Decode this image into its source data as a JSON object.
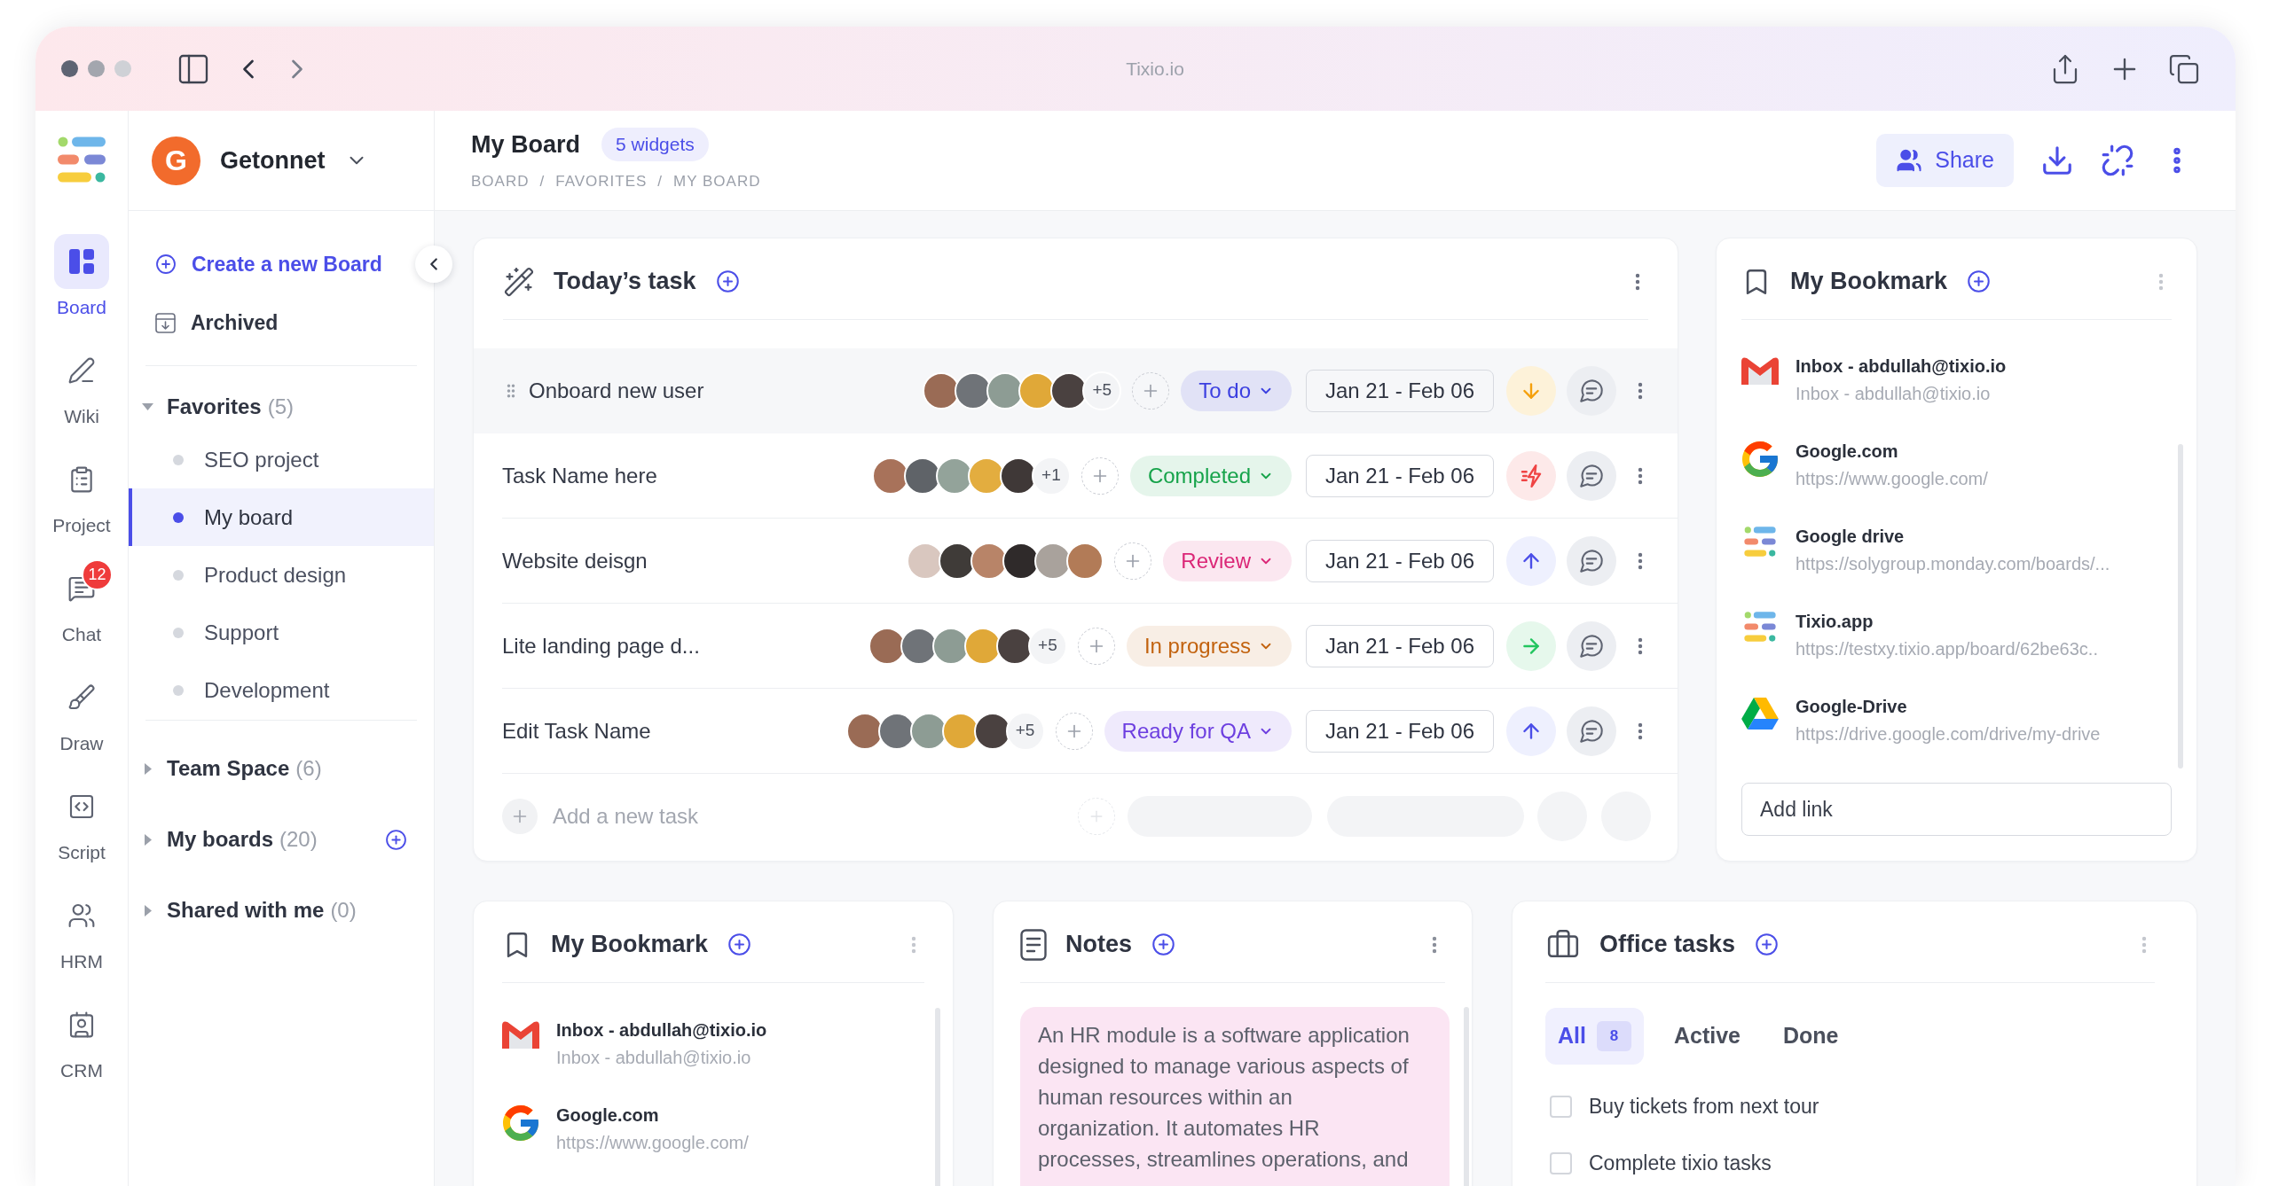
{
  "window": {
    "title": "Tixio.io"
  },
  "rail": {
    "items": [
      {
        "label": "Board",
        "selected": true
      },
      {
        "label": "Wiki",
        "selected": false
      },
      {
        "label": "Project",
        "selected": false
      },
      {
        "label": "Chat",
        "selected": false,
        "badge": "12"
      },
      {
        "label": "Draw",
        "selected": false
      },
      {
        "label": "Script",
        "selected": false
      },
      {
        "label": "HRM",
        "selected": false
      },
      {
        "label": "CRM",
        "selected": false
      }
    ]
  },
  "workspace": {
    "initial": "G",
    "name": "Getonnet"
  },
  "nav": {
    "actions": [
      {
        "label": "Create a new Board",
        "kind": "create"
      },
      {
        "label": "Archived",
        "kind": "archive"
      }
    ],
    "sections": [
      {
        "label": "Favorites",
        "count": "(5)",
        "expanded": true,
        "children": [
          {
            "label": "SEO project",
            "selected": false
          },
          {
            "label": "My board",
            "selected": true
          },
          {
            "label": "Product design",
            "selected": false
          },
          {
            "label": "Support",
            "selected": false
          },
          {
            "label": "Development",
            "selected": false
          }
        ]
      },
      {
        "label": "Team Space",
        "count": "(6)",
        "expanded": false
      },
      {
        "label": "My boards",
        "count": "(20)",
        "expanded": false,
        "action": {
          "kind": "add"
        }
      },
      {
        "label": "Shared with me",
        "count": "(0)",
        "expanded": false
      }
    ]
  },
  "header": {
    "title": "My Board",
    "badge": "5 widgets",
    "breadcrumb": [
      {
        "label": "BOARD",
        "separator": "/"
      },
      {
        "label": "FAVORITES",
        "separator": "/"
      },
      {
        "label": "MY BOARD"
      }
    ],
    "share_label": "Share"
  },
  "todays_task": {
    "title": "Today’s task",
    "tasks": [
      {
        "name": "Onboard new user",
        "highlighted": true,
        "avatars": [
          {
            "color": "#9a6b55"
          },
          {
            "color": "#6f7378"
          },
          {
            "color": "#8d9c94"
          },
          {
            "color": "#e0a838"
          },
          {
            "color": "#4a4140"
          }
        ],
        "more": "+5",
        "status": {
          "label": "To do",
          "color": "#3b3fe0"
        },
        "date": "Jan 21 - Feb 06",
        "priority": {
          "kind": "low"
        }
      },
      {
        "name": "Task Name here",
        "highlighted": false,
        "avatars": [
          {
            "color": "#a8725a"
          },
          {
            "color": "#5f6368"
          },
          {
            "color": "#93a39a"
          },
          {
            "color": "#e3ad3f"
          },
          {
            "color": "#3f3837"
          }
        ],
        "more": "+1",
        "status": {
          "label": "Completed",
          "color": "#16a34a"
        },
        "date": "Jan 21 - Feb 06",
        "priority": {
          "kind": "urgent"
        }
      },
      {
        "name": "Website deisgn",
        "highlighted": false,
        "avatars": [
          {
            "color": "#d9c7bf"
          },
          {
            "color": "#3f3b38"
          },
          {
            "color": "#b88468"
          },
          {
            "color": "#2f2a2a"
          },
          {
            "color": "#a9a29c"
          },
          {
            "color": "#b27b57"
          }
        ],
        "status": {
          "label": "Review",
          "color": "#db2777"
        },
        "date": "Jan 21 - Feb 06",
        "priority": {
          "kind": "high"
        }
      },
      {
        "name": "Lite landing page d...",
        "highlighted": false,
        "avatars": [
          {
            "color": "#9a6b55"
          },
          {
            "color": "#6f7378"
          },
          {
            "color": "#8d9c94"
          },
          {
            "color": "#e0a838"
          },
          {
            "color": "#4a4140"
          }
        ],
        "more": "+5",
        "status": {
          "label": "In progress",
          "color": "#c2620e"
        },
        "date": "Jan 21 - Feb 06",
        "priority": {
          "kind": "medium"
        }
      },
      {
        "name": "Edit Task Name",
        "highlighted": false,
        "avatars": [
          {
            "color": "#9a6b55"
          },
          {
            "color": "#6f7378"
          },
          {
            "color": "#8d9c94"
          },
          {
            "color": "#e0a838"
          },
          {
            "color": "#4a4140"
          }
        ],
        "more": "+5",
        "status": {
          "label": "Ready for QA",
          "color": "#6d3fe0"
        },
        "date": "Jan 21 - Feb 06",
        "priority": {
          "kind": "high"
        }
      }
    ],
    "new_task_placeholder": "Add a new task"
  },
  "bookmarks": {
    "title": "My Bookmark",
    "items": [
      {
        "title": "Inbox - abdullah@tixio.io",
        "url": "Inbox - abdullah@tixio.io"
      },
      {
        "title": "Google.com",
        "url": "https://www.google.com/"
      },
      {
        "title": "Google drive",
        "url": "https://solygroup.monday.com/boards/..."
      },
      {
        "title": "Tixio.app",
        "url": "https://testxy.tixio.app/board/62be63c.."
      },
      {
        "title": "Google-Drive",
        "url": "https://drive.google.com/drive/my-drive"
      }
    ],
    "add_link_placeholder": "Add link"
  },
  "bookmarks_bottom": {
    "title": "My Bookmark",
    "items": [
      {
        "title": "Inbox - abdullah@tixio.io",
        "url": "Inbox - abdullah@tixio.io"
      },
      {
        "title": "Google.com",
        "url": "https://www.google.com/"
      }
    ]
  },
  "notes": {
    "title": "Notes",
    "text": "An HR module is a software application designed to manage various aspects of human resources within an organization. It automates HR processes, streamlines operations, and"
  },
  "office_tasks": {
    "title": "Office tasks",
    "tabs": [
      {
        "label": "All",
        "count": "8",
        "selected": true
      },
      {
        "label": "Active",
        "selected": false
      },
      {
        "label": "Done",
        "selected": false
      }
    ],
    "items": [
      {
        "label": "Buy tickets from next tour",
        "checked": false
      },
      {
        "label": "Complete tixio tasks",
        "checked": false
      }
    ]
  }
}
